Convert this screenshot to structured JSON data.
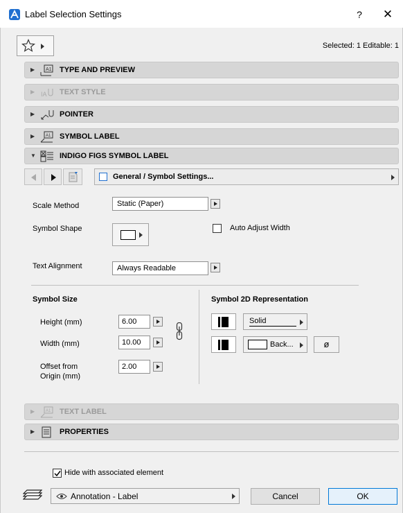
{
  "window": {
    "title": "Label Selection Settings",
    "help": "?",
    "close": "✕"
  },
  "toolbar": {
    "favorites_icon": "star-icon",
    "selection_info": "Selected: 1 Editable: 1"
  },
  "panels": {
    "type_preview": "TYPE AND PREVIEW",
    "text_style": "TEXT STYLE",
    "pointer": "POINTER",
    "symbol_label": "SYMBOL LABEL",
    "indigo": "INDIGO FIGS SYMBOL LABEL",
    "text_label": "TEXT LABEL",
    "properties": "PROPERTIES"
  },
  "nav": {
    "settings_page": "General / Symbol Settings..."
  },
  "general": {
    "scale_method_label": "Scale Method",
    "scale_method_value": "Static (Paper)",
    "symbol_shape_label": "Symbol Shape",
    "auto_adjust_label": "Auto Adjust Width",
    "auto_adjust_checked": false,
    "text_alignment_label": "Text Alignment",
    "text_alignment_value": "Always Readable"
  },
  "symbol_size": {
    "header": "Symbol Size",
    "height_label": "Height (mm)",
    "height_value": "6.00",
    "width_label": "Width (mm)",
    "width_value": "10.00",
    "offset_label_1": "Offset from",
    "offset_label_2": "Origin (mm)",
    "offset_value": "2.00"
  },
  "representation": {
    "header": "Symbol 2D Representation",
    "line_type": "Solid",
    "fill": "Back...",
    "empty_symbol": "ø"
  },
  "footer": {
    "hide_label": "Hide with associated element",
    "hide_checked": true,
    "layer": "Annotation - Label",
    "cancel": "Cancel",
    "ok": "OK"
  },
  "colors": {
    "accent": "#0078d7",
    "app_icon": "#1f6fd0",
    "panel_header": "#d6d6d6",
    "dialog_bg": "#f0f0f0"
  }
}
